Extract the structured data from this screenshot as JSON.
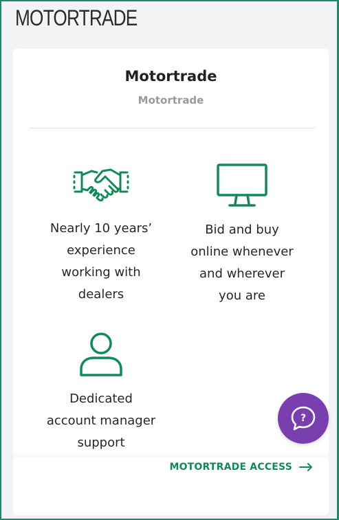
{
  "brand": {
    "logo_text": "MOTORTRADE"
  },
  "card": {
    "title": "Motortrade",
    "subtitle": "Motortrade"
  },
  "features": [
    {
      "icon": "handshake-icon",
      "lines": [
        "Nearly 10 years’",
        "experience",
        "working with",
        "dealers"
      ]
    },
    {
      "icon": "monitor-icon",
      "lines": [
        "Bid and buy",
        "online whenever",
        "and wherever",
        "you are"
      ]
    },
    {
      "icon": "user-icon",
      "lines": [
        "Dedicated",
        "account manager",
        "support"
      ]
    }
  ],
  "access_link": {
    "label": "MOTORTRADE ACCESS",
    "icon": "arrow-right-icon"
  },
  "chat": {
    "label": "?",
    "icon": "chat-help-icon"
  },
  "colors": {
    "accent_green": "#118a5a",
    "chat_purple": "#7a3fae",
    "frame_green": "#1a8a6c"
  }
}
